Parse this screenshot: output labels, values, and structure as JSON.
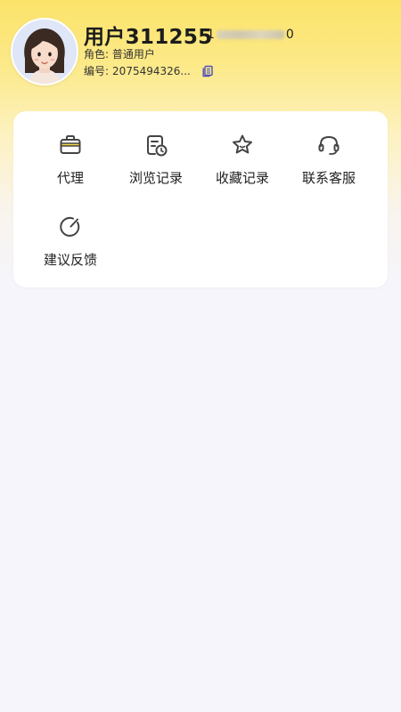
{
  "profile": {
    "username": "用户311255",
    "phone_prefix": "1",
    "phone_suffix": "0",
    "role_label": "角色:",
    "role_value": "普通用户",
    "id_label": "编号:",
    "id_value": "2075494326..."
  },
  "menu": {
    "items": [
      {
        "label": "代理",
        "icon": "briefcase-icon"
      },
      {
        "label": "浏览记录",
        "icon": "history-icon"
      },
      {
        "label": "收藏记录",
        "icon": "star-icon"
      },
      {
        "label": "联系客服",
        "icon": "headset-icon"
      },
      {
        "label": "建议反馈",
        "icon": "feedback-icon"
      }
    ]
  },
  "colors": {
    "accent_yellow": "#fbe36a",
    "icon_stroke": "#444444",
    "copy_icon": "#4b4fb8"
  }
}
